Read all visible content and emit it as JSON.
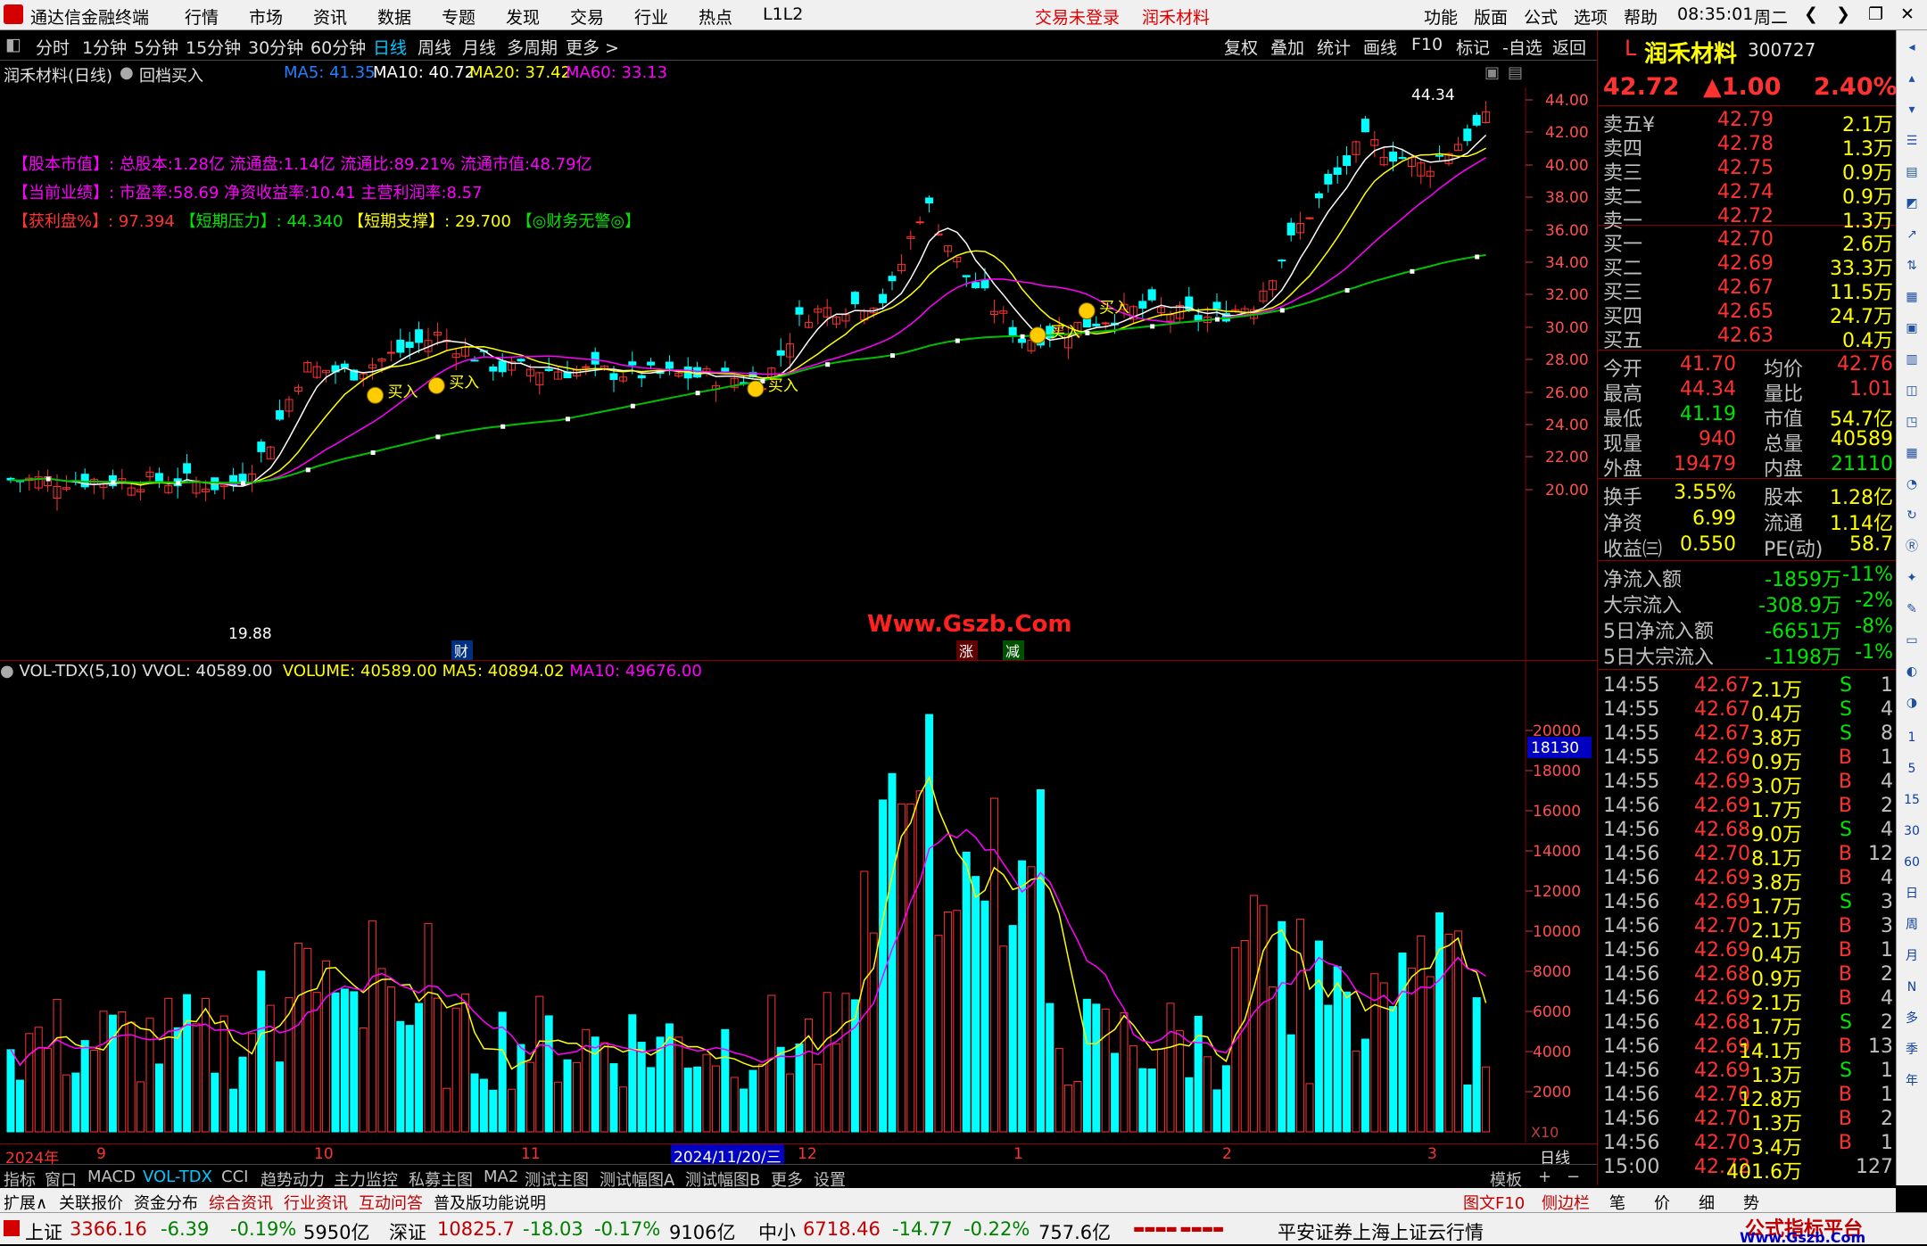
{
  "app": {
    "title": "通达信金融终端",
    "menus": [
      "行情",
      "市场",
      "资讯",
      "数据",
      "专题",
      "发现",
      "交易",
      "行业",
      "热点",
      "L1L2"
    ],
    "trade_status": "交易未登录",
    "stock_short": "润禾材料",
    "right_menus": [
      "功能",
      "版面",
      "公式",
      "选项",
      "帮助"
    ],
    "time": "08:35:01",
    "weekday": "周二"
  },
  "timeframes": [
    "分时",
    "1分钟",
    "5分钟",
    "15分钟",
    "30分钟",
    "60分钟",
    "日线",
    "周线",
    "月线",
    "多周期",
    "更多 >"
  ],
  "chart_tools": [
    "复权",
    "叠加",
    "统计",
    "画线",
    "F10",
    "标记",
    "-自选",
    "返回"
  ],
  "header": {
    "name": "润禾材料(日线)",
    "formula": "回档买入",
    "ma5": "MA5: 41.35",
    "ma10": "MA10: 40.72",
    "ma20": "MA20: 37.42",
    "ma60": "MA60: 33.13"
  },
  "info_lines": {
    "l1_tag": "【股本市值】:",
    "l1_text": "总股本:1.28亿 流通盘:1.14亿 流通比:89.21% 流通市值:48.79亿",
    "l2_tag": "【当前业绩】:",
    "l2_text": "市盈率:58.69 净资收益率:10.41 主营利润率:8.57",
    "l3_a": "【获利盘%】:",
    "l3_b": "97.394",
    "l3_c": "【短期压力】:",
    "l3_d": "44.340",
    "l3_e": "【短期支撑】:",
    "l3_f": "29.700",
    "l3_g": "【◎财务无警◎】"
  },
  "price_axis": [
    "44.00",
    "42.00",
    "40.00",
    "38.00",
    "36.00",
    "34.00",
    "32.00",
    "30.00",
    "28.00",
    "26.00",
    "24.00",
    "22.00",
    "20.00"
  ],
  "high_label": "44.34",
  "low_label": "19.88",
  "buy_label": "买入",
  "watermark": "Www.Gszb.Com",
  "markers": {
    "cai": "财",
    "zhang": "涨",
    "jian": "减"
  },
  "vol_header": {
    "name": "VOL-TDX(5,10)",
    "vvol": "VVOL: 40589.00",
    "volume": "VOLUME: 40589.00",
    "ma5": "MA5: 40894.02",
    "ma10": "MA10: 49676.00"
  },
  "vol_axis": [
    "20000",
    "18000",
    "16000",
    "14000",
    "12000",
    "10000",
    "8000",
    "6000",
    "4000",
    "2000"
  ],
  "vol_cursor": "18130",
  "vol_unit": "X10",
  "date_axis": [
    "2024年",
    "9",
    "10",
    "11",
    "12",
    "1",
    "2",
    "3"
  ],
  "date_cursor": "2024/11/20/三",
  "period_label": "日线",
  "indicator_tabs": [
    "指标",
    "窗口",
    "MACD",
    "VOL-TDX",
    "CCI",
    "趋势动力",
    "主力监控",
    "私募主图",
    "MA2",
    "测试主图",
    "测试幅图A",
    "测试幅图B",
    "更多",
    "设置"
  ],
  "template_label": "模板",
  "plus": "+",
  "minus": "−",
  "bottom_tabs": [
    "扩展∧",
    "关联报价",
    "资金分布",
    "综合资讯",
    "行业资讯",
    "互动问答",
    "普及版功能说明"
  ],
  "bottom_right": [
    "图文F10",
    "侧边栏《",
    "笔",
    "价",
    "细",
    "势"
  ],
  "quote": {
    "name": "润禾材料",
    "code": "300727",
    "price": "42.72",
    "change": "▲1.00",
    "pct": "2.40%",
    "asks": [
      [
        "卖五¥",
        "42.79",
        "2.1万"
      ],
      [
        "卖四",
        "42.78",
        "1.3万"
      ],
      [
        "卖三",
        "42.75",
        "0.9万"
      ],
      [
        "卖二",
        "42.74",
        "0.9万"
      ],
      [
        "卖一",
        "42.72",
        "1.3万"
      ]
    ],
    "bids": [
      [
        "买一",
        "42.70",
        "2.6万"
      ],
      [
        "买二",
        "42.69",
        "33.3万"
      ],
      [
        "买三",
        "42.67",
        "11.5万"
      ],
      [
        "买四",
        "42.65",
        "24.7万"
      ],
      [
        "买五",
        "42.63",
        "0.4万"
      ]
    ],
    "stats": [
      [
        "今开",
        "41.70",
        "均价",
        "42.76"
      ],
      [
        "最高",
        "44.34",
        "量比",
        "1.01"
      ],
      [
        "最低",
        "41.19",
        "市值",
        "54.7亿"
      ],
      [
        "现量",
        "940",
        "总量",
        "40589"
      ],
      [
        "外盘",
        "19479",
        "内盘",
        "21110"
      ]
    ],
    "stats2": [
      [
        "换手",
        "3.55%",
        "股本",
        "1.28亿"
      ],
      [
        "净资",
        "6.99",
        "流通",
        "1.14亿"
      ],
      [
        "收益㈢",
        "0.550",
        "PE(动)",
        "58.7"
      ]
    ],
    "flows": [
      [
        "净流入额",
        "-1859万",
        "-11%"
      ],
      [
        "大宗流入",
        "-308.9万",
        "-2%"
      ],
      [
        "5日净流入额",
        "-6651万",
        "-8%"
      ],
      [
        "5日大宗流入",
        "-1198万",
        "-1%"
      ]
    ]
  },
  "ticks": [
    [
      "14:55",
      "42.67",
      "2.1万",
      "S",
      "1"
    ],
    [
      "14:55",
      "42.67",
      "0.4万",
      "S",
      "4"
    ],
    [
      "14:55",
      "42.67",
      "3.8万",
      "S",
      "8"
    ],
    [
      "14:55",
      "42.69",
      "0.9万",
      "B",
      "1"
    ],
    [
      "14:55",
      "42.69",
      "3.0万",
      "B",
      "4"
    ],
    [
      "14:56",
      "42.69",
      "1.7万",
      "B",
      "2"
    ],
    [
      "14:56",
      "42.68",
      "9.0万",
      "S",
      "4"
    ],
    [
      "14:56",
      "42.70",
      "8.1万",
      "B",
      "12"
    ],
    [
      "14:56",
      "42.69",
      "3.8万",
      "B",
      "4"
    ],
    [
      "14:56",
      "42.69",
      "1.7万",
      "S",
      "3"
    ],
    [
      "14:56",
      "42.70",
      "2.1万",
      "B",
      "3"
    ],
    [
      "14:56",
      "42.69",
      "0.4万",
      "B",
      "1"
    ],
    [
      "14:56",
      "42.68",
      "0.9万",
      "B",
      "2"
    ],
    [
      "14:56",
      "42.69",
      "2.1万",
      "B",
      "4"
    ],
    [
      "14:56",
      "42.68",
      "1.7万",
      "S",
      "2"
    ],
    [
      "14:56",
      "42.69",
      "14.1万",
      "B",
      "13"
    ],
    [
      "14:56",
      "42.69",
      "1.3万",
      "S",
      "1"
    ],
    [
      "14:56",
      "42.70",
      "12.8万",
      "B",
      "1"
    ],
    [
      "14:56",
      "42.70",
      "1.3万",
      "B",
      "2"
    ],
    [
      "14:56",
      "42.70",
      "3.4万",
      "B",
      "1"
    ],
    [
      "15:00",
      "42.72",
      "401.6万",
      "",
      "127"
    ]
  ],
  "side_tools": [
    "1",
    "5",
    "15",
    "30",
    "60",
    "日",
    "周",
    "月",
    "N",
    "多",
    "季",
    "年"
  ],
  "status": {
    "sh": "上证",
    "sh_val": "3366.16",
    "sh_chg": "-6.39",
    "sh_pct": "-0.19%",
    "sh_amt": "5950亿",
    "sz": "深证",
    "sz_val": "10825.7",
    "sz_chg": "-18.03",
    "sz_pct": "-0.17%",
    "sz_amt": "9106亿",
    "zx": "中小",
    "zx_val": "6718.46",
    "zx_chg": "-14.77",
    "zx_pct": "-0.22%",
    "zx_amt": "757.6亿",
    "server": "平安证券上海上证云行情",
    "brand1": "公式指标平台",
    "brand2": "Www.Gszb.Com"
  }
}
